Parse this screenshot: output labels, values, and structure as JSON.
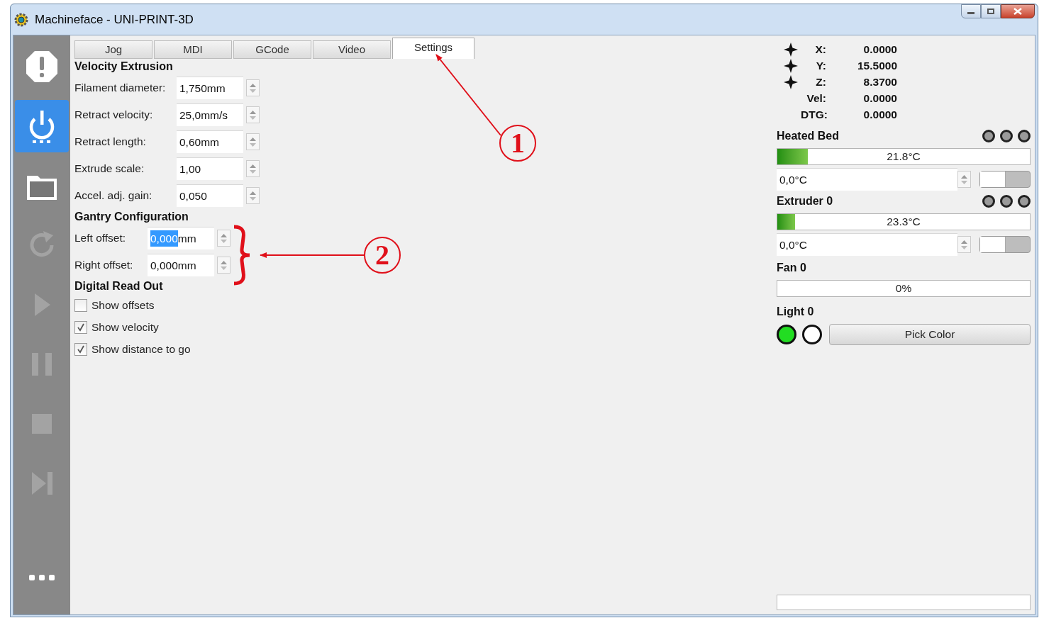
{
  "window": {
    "title": "Machineface - UNI-PRINT-3D"
  },
  "sidebar": {
    "items": [
      {
        "kind": "alert",
        "selected": false,
        "disabled": false
      },
      {
        "kind": "power",
        "selected": true,
        "disabled": false
      },
      {
        "kind": "folder",
        "selected": false,
        "disabled": false
      },
      {
        "kind": "reload",
        "selected": false,
        "disabled": true
      },
      {
        "kind": "play",
        "selected": false,
        "disabled": true
      },
      {
        "kind": "pause",
        "selected": false,
        "disabled": true
      },
      {
        "kind": "stop",
        "selected": false,
        "disabled": true
      },
      {
        "kind": "step",
        "selected": false,
        "disabled": true
      },
      {
        "kind": "more",
        "selected": false,
        "disabled": false
      }
    ]
  },
  "tabs": [
    {
      "label": "Jog",
      "selected": false
    },
    {
      "label": "MDI",
      "selected": false
    },
    {
      "label": "GCode",
      "selected": false
    },
    {
      "label": "Video",
      "selected": false
    },
    {
      "label": "Settings",
      "selected": true
    }
  ],
  "sections": [
    {
      "title": "Velocity Extrusion",
      "rows": [
        {
          "kind": "spin",
          "label": "Filament diameter:",
          "value_parts": [
            {
              "text": "1,750mm",
              "selected": false
            }
          ]
        },
        {
          "kind": "spin",
          "label": "Retract velocity:",
          "value_parts": [
            {
              "text": "25,0mm/s",
              "selected": false
            }
          ]
        },
        {
          "kind": "spin",
          "label": "Retract length:",
          "value_parts": [
            {
              "text": "0,60mm",
              "selected": false
            }
          ]
        },
        {
          "kind": "spin",
          "label": "Extrude scale:",
          "value_parts": [
            {
              "text": "1,00",
              "selected": false
            }
          ]
        },
        {
          "kind": "spin",
          "label": "Accel. adj. gain:",
          "value_parts": [
            {
              "text": "0,050",
              "selected": false
            }
          ]
        }
      ]
    },
    {
      "title": "Gantry Configuration",
      "rows": [
        {
          "kind": "spin",
          "label": "Left offset:",
          "value_parts": [
            {
              "text": "0,000",
              "selected": true
            },
            {
              "text": "mm",
              "selected": false
            }
          ]
        },
        {
          "kind": "spin",
          "label": "Right offset:",
          "value_parts": [
            {
              "text": "0,000mm",
              "selected": false
            }
          ]
        }
      ]
    },
    {
      "title": "Digital Read Out",
      "rows": [
        {
          "kind": "check",
          "label": "Show offsets",
          "checked": false
        },
        {
          "kind": "check",
          "label": "Show velocity",
          "checked": true
        },
        {
          "kind": "check",
          "label": "Show distance to go",
          "checked": true
        }
      ]
    }
  ],
  "annotations": [
    {
      "label": "1"
    },
    {
      "label": "2"
    }
  ],
  "readout": [
    {
      "kind": "axis",
      "label": "X:",
      "value": "0.0000"
    },
    {
      "kind": "axis",
      "label": "Y:",
      "value": "15.5000"
    },
    {
      "kind": "axis",
      "label": "Z:",
      "value": "8.3700"
    },
    {
      "kind": "info",
      "label": "Vel:",
      "value": "0.0000"
    },
    {
      "kind": "info",
      "label": "DTG:",
      "value": "0.0000"
    }
  ],
  "heaters": [
    {
      "name": "Heated Bed",
      "leds": [
        {
          "on": false
        },
        {
          "on": false
        },
        {
          "on": false
        }
      ],
      "level": 0.12,
      "reading": "21.8°C",
      "setpoint": "0,0°C",
      "on": false
    },
    {
      "name": "Extruder 0",
      "leds": [
        {
          "on": false
        },
        {
          "on": false
        },
        {
          "on": false
        }
      ],
      "level": 0.07,
      "reading": "23.3°C",
      "setpoint": "0,0°C",
      "on": false
    }
  ],
  "fan": {
    "name": "Fan 0",
    "level": 0,
    "reading": "0%"
  },
  "light": {
    "name": "Light 0",
    "swatches": [
      {
        "color": "#22dd22"
      },
      {
        "color": "#ffffff"
      }
    ],
    "button": "Pick Color"
  }
}
